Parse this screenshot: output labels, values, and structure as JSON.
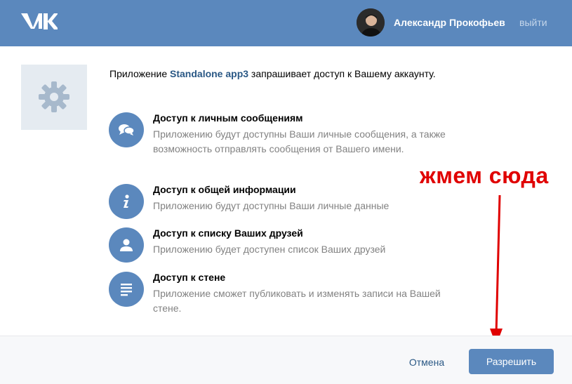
{
  "header": {
    "logo_icon": "vk-logo-icon",
    "user_name": "Александр Прокофьев",
    "logout_label": "выйти"
  },
  "app": {
    "icon": "gear-icon",
    "intro_prefix": "Приложение ",
    "app_name": "Standalone app3",
    "intro_suffix": " запрашивает доступ к Вашему аккаунту."
  },
  "permissions": [
    {
      "icon": "chat-bubbles-icon",
      "title": "Доступ к личным сообщениям",
      "description": "Приложению будут доступны Ваши личные сообщения, а также возможность отправлять сообщения от Вашего имени."
    },
    {
      "icon": "info-icon",
      "title": "Доступ к общей информации",
      "description": "Приложению будут доступны Ваши личные данные"
    },
    {
      "icon": "person-icon",
      "title": "Доступ к списку Ваших друзей",
      "description": "Приложению будет доступен список Ваших друзей"
    },
    {
      "icon": "wall-lines-icon",
      "title": "Доступ к стене",
      "description": "Приложение сможет публиковать и изменять записи на Вашей стене."
    }
  ],
  "annotation": {
    "text": "жмем сюда",
    "color": "#e00000"
  },
  "footer": {
    "cancel_label": "Отмена",
    "allow_label": "Разрешить"
  },
  "colors": {
    "brand": "#5b88bd",
    "link": "#2a5885"
  }
}
